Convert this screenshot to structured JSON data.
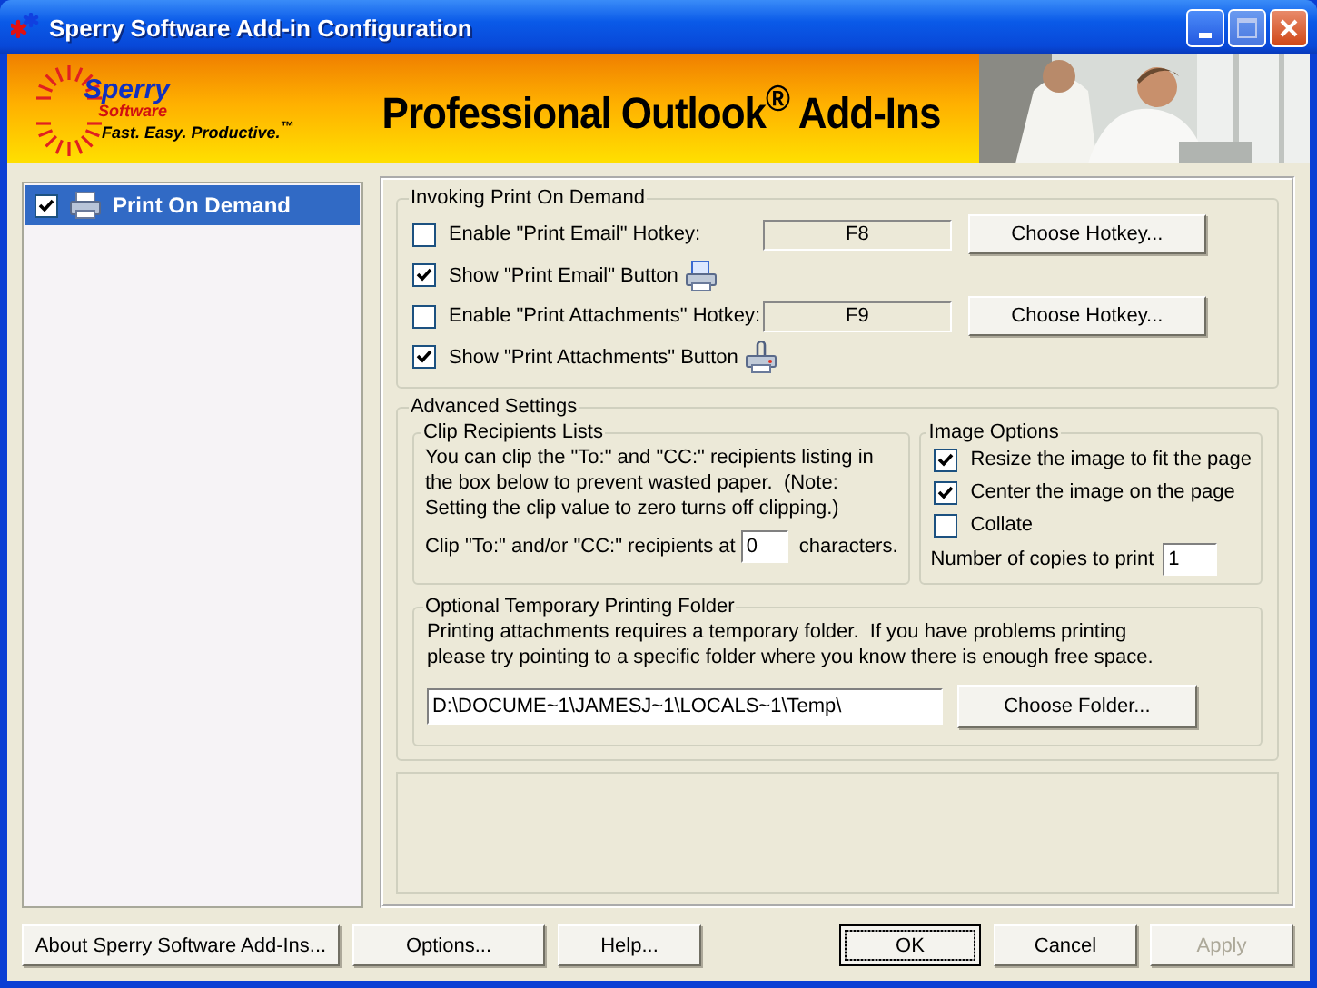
{
  "window": {
    "title": "Sperry Software Add-in Configuration"
  },
  "banner": {
    "logo_name": "Sperry",
    "logo_sub": "Software",
    "tagline": "Fast. Easy. Productive.$^{™}$",
    "headline": "Professional Outlook$^{®}$ Add-Ins"
  },
  "tree": [
    {
      "label": "Print On Demand",
      "checked": true,
      "selected": true
    }
  ],
  "invoking": {
    "title": "Invoking Print On Demand",
    "rows": [
      {
        "kind": "hotkey",
        "label": "Enable \"Print Email\" Hotkey:",
        "checked": false,
        "value": "F8",
        "button": "Choose Hotkey..."
      },
      {
        "kind": "toggle",
        "label": "Show \"Print Email\" Button",
        "checked": true
      },
      {
        "kind": "hotkey",
        "label": "Enable \"Print Attachments\" Hotkey:",
        "checked": false,
        "value": "F9",
        "button": "Choose Hotkey..."
      },
      {
        "kind": "toggle",
        "label": "Show \"Print Attachments\" Button",
        "checked": true
      }
    ]
  },
  "advanced": {
    "title": "Advanced Settings",
    "clip": {
      "title": "Clip Recipients Lists",
      "text": "You can clip the \"To:\" and \"CC:\" recipients listing in the box below to prevent wasted paper.  (Note: Setting the clip value to zero turns off clipping.)",
      "prefix": "Clip \"To:\" and/or \"CC:\" recipients at",
      "value": "0",
      "suffix": "characters."
    },
    "image": {
      "title": "Image Options",
      "options": [
        {
          "label": "Resize the image to fit the page",
          "checked": true
        },
        {
          "label": "Center the image on the page",
          "checked": true
        },
        {
          "label": "Collate",
          "checked": false
        }
      ],
      "copies_label": "Number of copies to print",
      "copies": "1"
    },
    "folder": {
      "title": "Optional Temporary Printing Folder",
      "text": "Printing attachments requires a temporary folder.  If you have problems printing please try pointing to a specific folder where you know there is enough free space.",
      "path": "D:\\DOCUME~1\\JAMESJ~1\\LOCALS~1\\Temp\\",
      "button": "Choose Folder..."
    }
  },
  "buttons": [
    {
      "label": "About Sperry Software Add-Ins...",
      "default": false,
      "disabled": false
    },
    {
      "label": "Options...",
      "default": false,
      "disabled": false
    },
    {
      "label": "Help...",
      "default": false,
      "disabled": false
    },
    {
      "label": "OK",
      "default": true,
      "disabled": false
    },
    {
      "label": "Cancel",
      "default": false,
      "disabled": false
    },
    {
      "label": "Apply",
      "default": false,
      "disabled": true
    }
  ]
}
